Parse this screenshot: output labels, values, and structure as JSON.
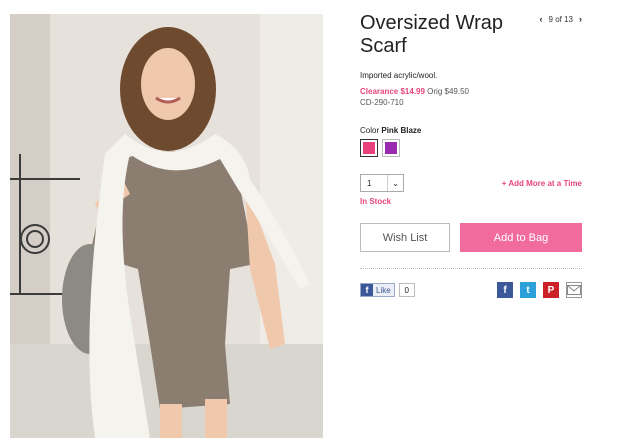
{
  "product": {
    "title": "Oversized Wrap Scarf",
    "description": "Imported acrylic/wool.",
    "clearance_label": "Clearance $14.99",
    "orig_label": "Orig $49.50",
    "sku": "CD-290-710",
    "color_prefix": "Color",
    "color_name": "Pink Blaze",
    "swatches": [
      {
        "name": "Pink Blaze",
        "color": "#e8407a"
      },
      {
        "name": "Purple",
        "color": "#9a2bb0"
      }
    ]
  },
  "pager": {
    "prev_icon": "chevron-left-icon",
    "text": "9 of 13",
    "next_icon": "chevron-right-icon"
  },
  "purchase": {
    "quantity": "1",
    "add_more": "+ Add More at a Time",
    "stock": "In Stock",
    "wish_list": "Wish List",
    "add_to_bag": "Add to Bag"
  },
  "social": {
    "like_label": "Like",
    "like_count": "0",
    "share_icons": [
      "facebook-icon",
      "twitter-icon",
      "pinterest-icon",
      "email-icon"
    ]
  },
  "colors": {
    "accent_pink": "#e8457e",
    "bag_button": "#f16b9c",
    "facebook": "#3b5998",
    "twitter": "#2a9fd8",
    "pinterest": "#cb2027"
  }
}
